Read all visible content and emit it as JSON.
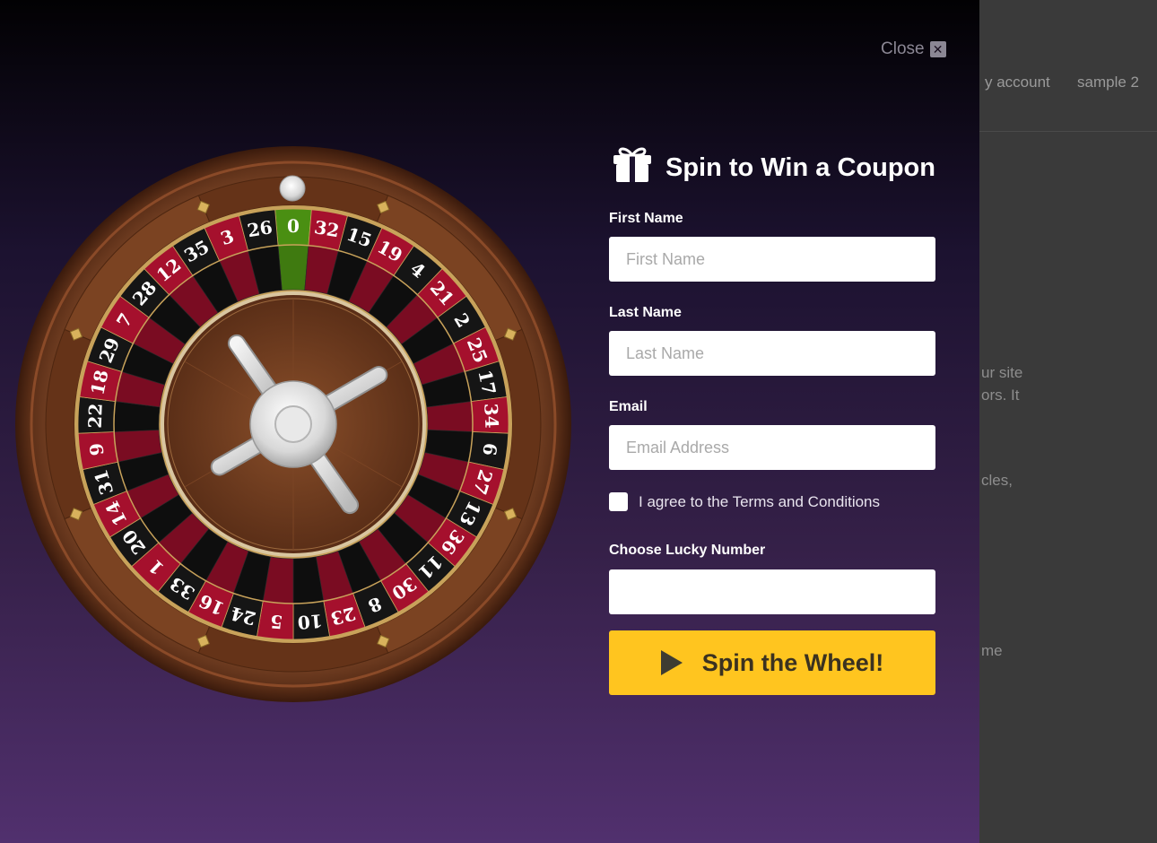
{
  "background_page": {
    "nav_items": [
      "y account",
      "sample 2"
    ],
    "text_fragments": [
      "ur site",
      "ors. It",
      "cles,",
      "me"
    ]
  },
  "popup": {
    "close_label": "Close",
    "close_icon": "close-x-icon",
    "title": "Spin to Win a Coupon",
    "title_icon": "gift-icon",
    "fields": {
      "first_name": {
        "label": "First Name",
        "placeholder": "First Name",
        "value": ""
      },
      "last_name": {
        "label": "Last Name",
        "placeholder": "Last Name",
        "value": ""
      },
      "email": {
        "label": "Email",
        "placeholder": "Email Address",
        "value": ""
      },
      "lucky_number": {
        "label": "Choose Lucky Number",
        "placeholder": "",
        "value": ""
      }
    },
    "terms": {
      "label": "I agree to the Terms and Conditions",
      "checked": false
    },
    "spin_button": {
      "label": "Spin the Wheel!",
      "icon": "play-icon"
    }
  },
  "wheel": {
    "numbers": [
      "0",
      "32",
      "15",
      "19",
      "4",
      "21",
      "2",
      "25",
      "17",
      "34",
      "6",
      "27",
      "13",
      "36",
      "11",
      "30",
      "8",
      "23",
      "10",
      "5",
      "24",
      "16",
      "33",
      "1",
      "20",
      "14",
      "31",
      "9",
      "22",
      "18",
      "29",
      "7",
      "28",
      "12",
      "35",
      "3",
      "26"
    ],
    "colors": {
      "green": "#4a8f12",
      "red": "#a5102d",
      "black": "#151515",
      "wood": "#6b3a1e"
    }
  }
}
